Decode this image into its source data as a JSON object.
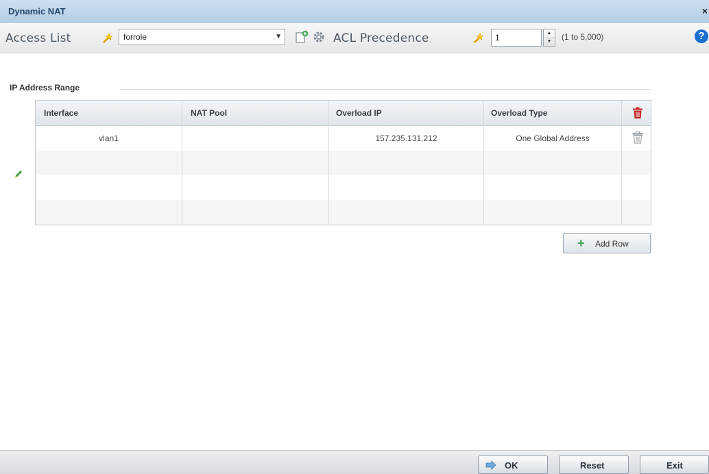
{
  "window": {
    "title": "Dynamic NAT",
    "close_glyph": "×"
  },
  "toolbar": {
    "access_list_label": "Access List",
    "access_list_value": "forrole",
    "acl_precedence_label": "ACL Precedence",
    "acl_precedence_value": "1",
    "acl_precedence_range": "(1 to 5,000)",
    "help_glyph": "?"
  },
  "group": {
    "label": "IP Address Range"
  },
  "table": {
    "columns": [
      "Interface",
      "NAT Pool",
      "Overload IP",
      "Overload Type"
    ],
    "rows": [
      {
        "interface": "vlan1",
        "nat_pool": "",
        "overload_ip": "157.235.131.212",
        "overload_type": "One Global Address"
      }
    ]
  },
  "add_row_label": "Add Row",
  "footer": {
    "ok_label": "OK",
    "reset_label": "Reset",
    "exit_label": "Exit"
  },
  "colors": {
    "accent": "#1c6fd1",
    "title_text": "#23466b",
    "delete_red": "#c62828",
    "add_green": "#3aa44a"
  }
}
